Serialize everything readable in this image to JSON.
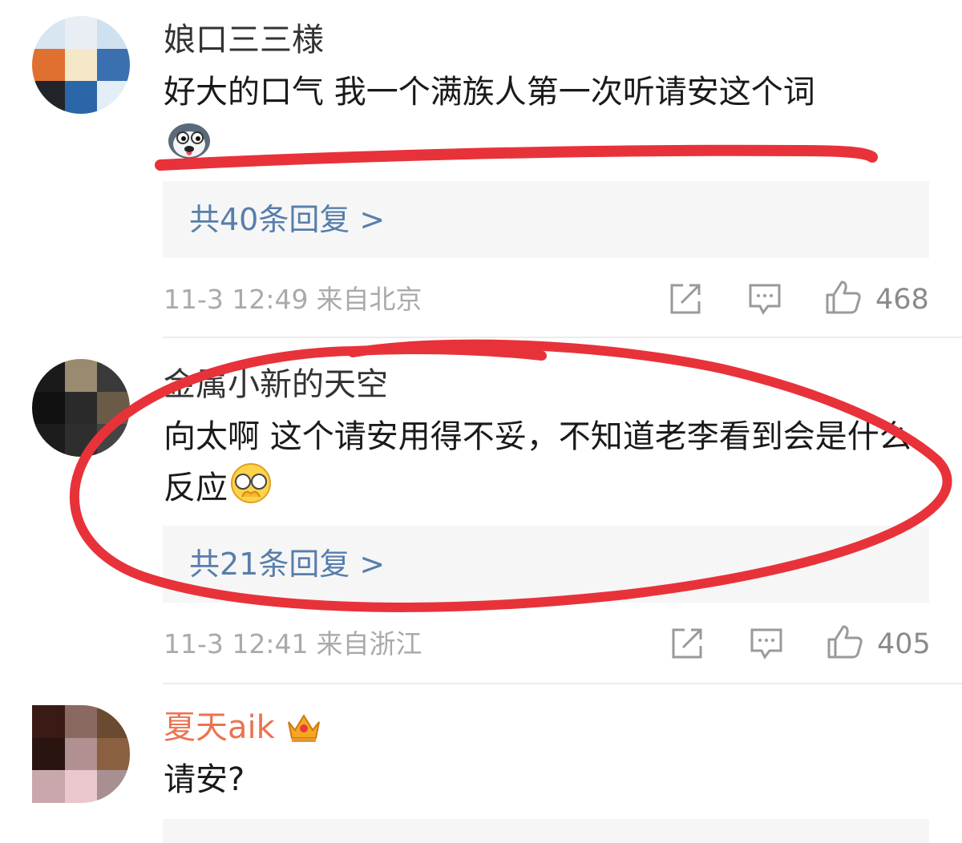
{
  "comments": [
    {
      "username": "娘口三三様",
      "text": "好大的口气 我一个满族人第一次听请安这个词",
      "emoji": "husky-emoji",
      "replies": "共40条回复 >",
      "time": "11-3 12:49",
      "location": "来自北京",
      "likes": "468"
    },
    {
      "username": "金属小新的天空",
      "text": "向太啊 这个请安用得不妥，不知道老李看到会是什么反应",
      "emoji": "covering-face-emoji",
      "replies": "共21条回复 >",
      "time": "11-3 12:41",
      "location": "来自浙江",
      "likes": "405"
    },
    {
      "username": "夏天aik",
      "badge": "crown-badge-icon",
      "text": "请安?"
    }
  ],
  "icons": {
    "share": "share-icon",
    "comment": "comment-icon",
    "like": "thumbs-up-icon"
  },
  "colors": {
    "link": "#577eab",
    "vip_name": "#eb7350",
    "annotation": "#e8323a",
    "meta": "#aaaaaa"
  }
}
